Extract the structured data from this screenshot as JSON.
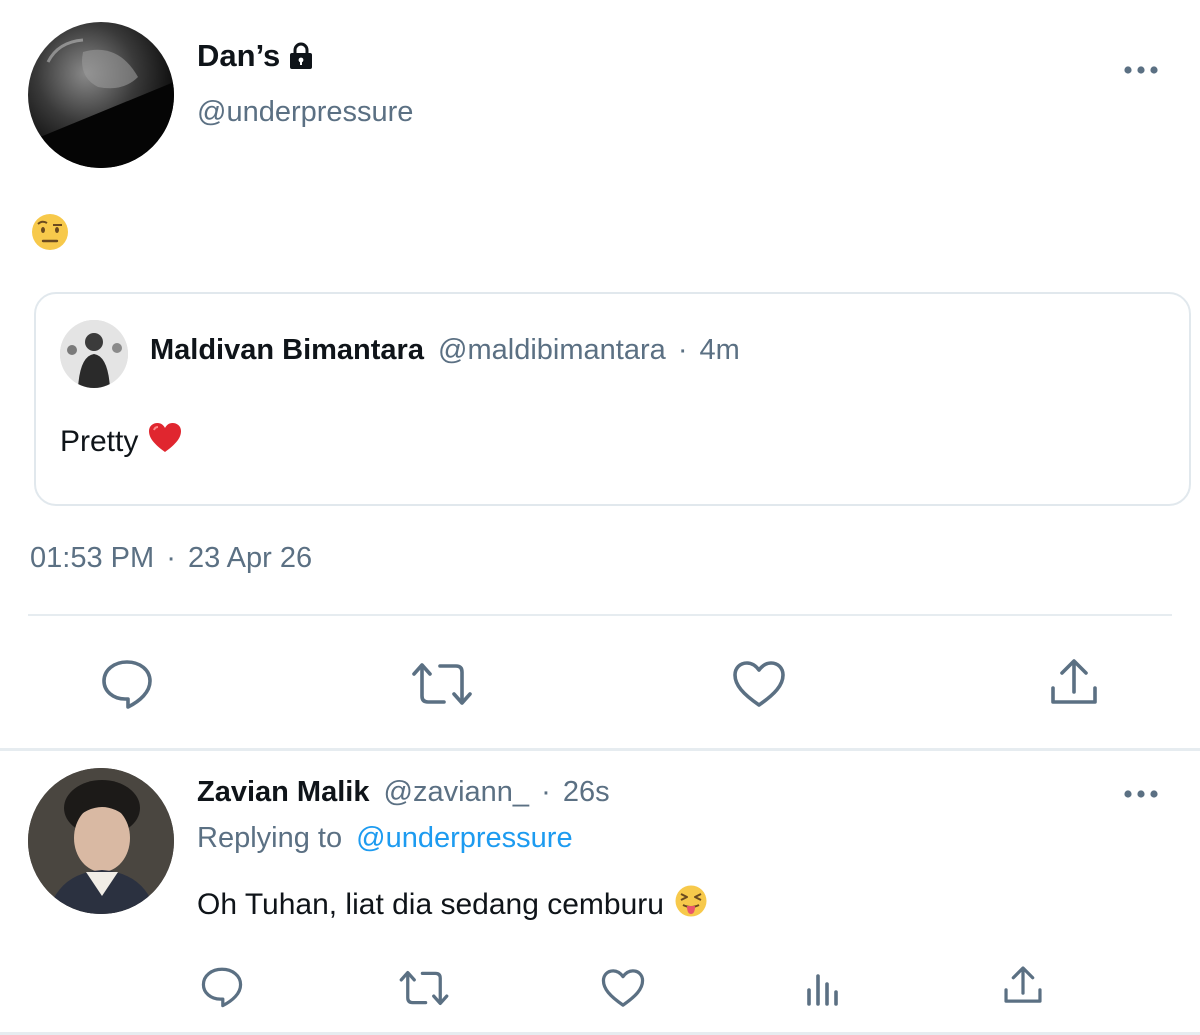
{
  "tweet": {
    "author": {
      "display_name": "Dan’s",
      "handle": "@underpressure",
      "protected_icon": "lock-icon"
    },
    "body_emoji": "face-with-raised-eyebrow",
    "quote": {
      "display_name": "Maldivan Bimantara",
      "handle": "@maldibimantara",
      "separator": "·",
      "time": "4m",
      "text": "Pretty",
      "emoji": "red-heart"
    },
    "timestamp": {
      "time": "01:53 PM",
      "separator": "·",
      "date": "23 Apr 26"
    },
    "actions": [
      "reply-icon",
      "retweet-icon",
      "like-icon",
      "share-icon"
    ]
  },
  "reply": {
    "display_name": "Zavian Malik",
    "handle": "@zaviann_",
    "separator": "·",
    "time": "26s",
    "replying_prefix": "Replying to",
    "replying_handle": "@underpressure",
    "text": "Oh Tuhan, liat dia sedang cemburu",
    "emoji": "squinting-face-with-tongue",
    "actions": [
      "reply-icon",
      "retweet-icon",
      "like-icon",
      "analytics-icon",
      "share-icon"
    ]
  },
  "colors": {
    "link": "#1d9bf0",
    "muted": "#5b7083",
    "text": "#0f1419",
    "border": "#e6ecf0"
  }
}
